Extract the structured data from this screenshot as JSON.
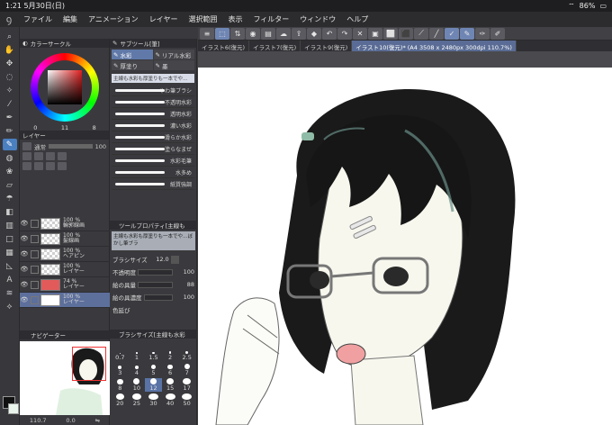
{
  "statusbar": {
    "time": "1:21",
    "date": "5月30日(日)",
    "battery": "86%"
  },
  "menu": [
    "ファイル",
    "編集",
    "アニメーション",
    "レイヤー",
    "選択範囲",
    "表示",
    "フィルター",
    "ウィンドウ",
    "ヘルプ"
  ],
  "toolbar": {
    "icons": [
      "menu",
      "transform",
      "layers",
      "undo",
      "redo",
      "save",
      "rotate",
      "stack",
      "fill",
      "text",
      "grid",
      "blend",
      "cloud",
      "brush",
      "pen"
    ]
  },
  "tabs": [
    "イラスト6(復元)",
    "イラスト7(復元)",
    "イラスト9(復元)",
    "イラスト10(復元)* (A4 3508 x 2480px 300dpi 110.7%)"
  ],
  "color_circle": {
    "title": "カラーサークル",
    "h": "0",
    "s": "11",
    "v": "8"
  },
  "layer_panel": {
    "title": "レイヤー",
    "blend_mode": "通常",
    "opacity": "100",
    "layers": [
      {
        "pct": "100 %",
        "name": "輪郭線画"
      },
      {
        "pct": "100 %",
        "name": "髪線画"
      },
      {
        "pct": "100 %",
        "name": "ヘアピン"
      },
      {
        "pct": "100 %",
        "name": "レイヤー"
      },
      {
        "pct": "74 %",
        "name": "レイヤー"
      },
      {
        "pct": "100 %",
        "name": "レイヤー"
      }
    ]
  },
  "navigator": {
    "title": "ナビゲーター",
    "zoom": "110.7",
    "rotate": "0.0"
  },
  "subtool": {
    "title": "サブツール[筆]",
    "groups": [
      "水彩",
      "リアル水彩",
      "厚塗り",
      "墨"
    ],
    "search": "主線も水彩も厚塗りも一本でや…",
    "brushes": [
      "やわ筆ブラシ",
      "不透明水彩",
      "透明水彩",
      "濃い水彩",
      "滑らか水彩",
      "塗らなまぜ",
      "水彩毛筆",
      "水多め",
      "紙質強調"
    ]
  },
  "tool_property": {
    "title": "ツールプロパティ[主線も",
    "preview_text": "主線も水彩も厚塗りも一本でや…ぼかし筆ブラ",
    "brush_size_label": "ブラシサイズ",
    "brush_size": "12.0",
    "opacity_label": "不透明度",
    "opacity": "100",
    "paint_amount_label": "絵の具量",
    "paint_amount": "88",
    "paint_density_label": "絵の具濃度",
    "paint_density": "100",
    "stretch_label": "色延び"
  },
  "brush_size_panel": {
    "title": "ブラシサイズ[主線も水彩",
    "sizes": [
      "0.7",
      "1",
      "1.5",
      "2",
      "2.5",
      "3",
      "4",
      "5",
      "6",
      "7",
      "8",
      "10",
      "12",
      "15",
      "17",
      "20",
      "25",
      "30",
      "40",
      "50"
    ],
    "selected": "12"
  }
}
